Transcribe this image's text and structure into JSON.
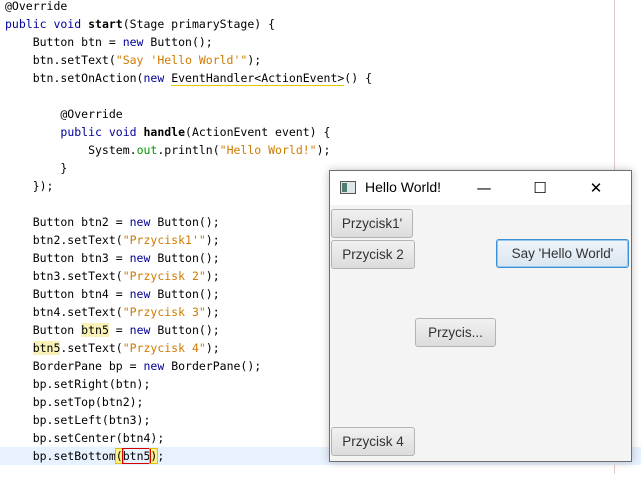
{
  "editor": {
    "lines": [
      "@Override",
      "public void start(Stage primaryStage) {",
      "Button btn = new Button();",
      "btn.setText(\"Say 'Hello World'\");",
      "btn.setOnAction(new EventHandler<ActionEvent>() {",
      "",
      "@Override",
      "public void handle(ActionEvent event) {",
      "System.out.println(\"Hello World!\");",
      "}",
      "});",
      "",
      "Button btn2 = new Button();",
      "btn2.setText(\"Przycisk1'\");",
      "Button btn3 = new Button();",
      "btn3.setText(\"Przycisk 2\");",
      "Button btn4 = new Button();",
      "btn4.setText(\"Przycisk 3\");",
      "Button btn5 = new Button();",
      "btn5.setText(\"Przycisk 4\");",
      "BorderPane bp = new BorderPane();",
      "bp.setRight(btn);",
      "bp.setTop(btn2);",
      "bp.setLeft(btn3);",
      "bp.setCenter(btn4);",
      "bp.setBottom(btn5);"
    ]
  },
  "window": {
    "title": "Hello World!",
    "minimize_glyph": "—",
    "maximize_glyph": "☐",
    "close_glyph": "✕",
    "buttons": {
      "top": "Przycisk1'",
      "left": "Przycisk 2",
      "right": "Say 'Hello World'",
      "center": "Przycis...",
      "bottom": "Przycisk 4"
    }
  },
  "colors": {
    "keyword": "#000099",
    "string": "#ce7b00",
    "field": "#009900",
    "current_line": "#e8f2fe",
    "focus_border": "#3d8fd6"
  }
}
